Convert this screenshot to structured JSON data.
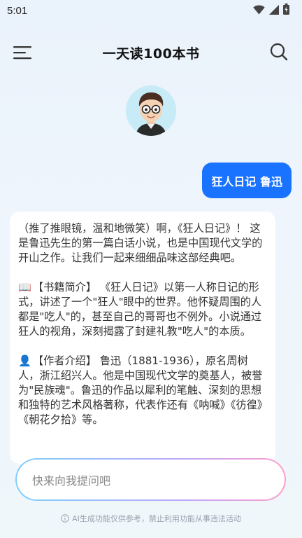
{
  "status_bar": {
    "time": "5:01"
  },
  "header": {
    "title": "一天读100本书"
  },
  "icons": {
    "menu": "menu-icon",
    "search": "search-icon",
    "wifi": "wifi-icon",
    "signal": "signal-icon",
    "battery": "battery-icon",
    "info": "info-icon"
  },
  "chat": {
    "user_message": "狂人日记 鲁迅",
    "ai_message": {
      "intro": "（推了推眼镜，温和地微笑）啊，《狂人日记》！ 这是鲁迅先生的第一篇白话小说，也是中国现代文学的开山之作。让我们一起来细细品味这部经典吧。",
      "book_intro_emoji": "📖",
      "book_intro": "【书籍简介】 《狂人日记》以第一人称日记的形式，讲述了一个\"狂人\"眼中的世界。他怀疑周围的人都是\"吃人\"的，甚至自己的哥哥也不例外。小说通过狂人的视角，深刻揭露了封建礼教\"吃人\"的本质。",
      "author_intro_emoji": "👤",
      "author_intro": "【作者介绍】 鲁迅（1881-1936），原名周树人，浙江绍兴人。他是中国现代文学的奠基人，被誉为\"民族魂\"。鲁迅的作品以犀利的笔触、深刻的思想和独特的艺术风格著称，代表作还有《呐喊》《彷徨》《朝花夕拾》等。"
    }
  },
  "input": {
    "placeholder": "快来向我提问吧"
  },
  "footer": {
    "disclaimer": "AI生成功能仅供参考，禁止利用功能从事违法活动"
  },
  "colors": {
    "accent": "#1a73ff",
    "background": "#eaf2fb"
  }
}
